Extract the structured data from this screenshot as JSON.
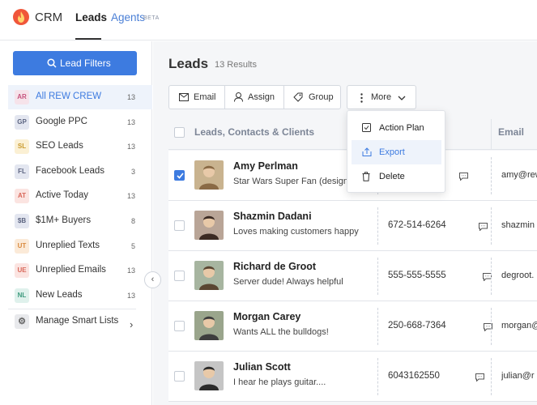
{
  "app": {
    "brand": "CRM"
  },
  "nav": {
    "tabs": [
      {
        "label": "Leads",
        "active": true
      },
      {
        "label": "Agents",
        "active": false
      }
    ],
    "beta_label": "BETA"
  },
  "sidebar": {
    "filter_button": "Lead Filters",
    "items": [
      {
        "badge": "AR",
        "label": "All REW CREW",
        "count": "13",
        "badge_bg": "#f6e3ea",
        "badge_color": "#c5537e",
        "active": true
      },
      {
        "badge": "GP",
        "label": "Google PPC",
        "count": "13",
        "badge_bg": "#e3e6f0",
        "badge_color": "#5c6480"
      },
      {
        "badge": "SL",
        "label": "SEO Leads",
        "count": "13",
        "badge_bg": "#fbf0d4",
        "badge_color": "#c99a2e"
      },
      {
        "badge": "FL",
        "label": "Facebook Leads",
        "count": "3",
        "badge_bg": "#e3e6f0",
        "badge_color": "#5c6480"
      },
      {
        "badge": "AT",
        "label": "Active Today",
        "count": "13",
        "badge_bg": "#fbe4e1",
        "badge_color": "#d9685a"
      },
      {
        "badge": "$B",
        "label": "$1M+ Buyers",
        "count": "8",
        "badge_bg": "#e3e6f0",
        "badge_color": "#5c6480"
      },
      {
        "badge": "UT",
        "label": "Unreplied Texts",
        "count": "5",
        "badge_bg": "#fbead8",
        "badge_color": "#d98a3e"
      },
      {
        "badge": "UE",
        "label": "Unreplied Emails",
        "count": "13",
        "badge_bg": "#fbe4e1",
        "badge_color": "#d9685a"
      },
      {
        "badge": "NL",
        "label": "New Leads",
        "count": "13",
        "badge_bg": "#dff1ec",
        "badge_color": "#3e9a7e"
      }
    ],
    "manage_label": "Manage Smart Lists"
  },
  "main": {
    "title": "Leads",
    "results": "13 Results",
    "toolbar": {
      "email": "Email",
      "assign": "Assign",
      "group": "Group",
      "more": "More"
    },
    "columns": {
      "leads": "Leads, Contacts & Clients",
      "email": "Email"
    },
    "rows": [
      {
        "name": "Amy Perlman",
        "desc": "Star Wars Super Fan (design",
        "phone": "",
        "email": "amy@rew",
        "checked": true
      },
      {
        "name": "Shazmin Dadani",
        "desc": "Loves making customers happy",
        "phone": "672-514-6264",
        "email": "shazmin",
        "checked": false
      },
      {
        "name": "Richard de Groot",
        "desc": "Server dude! Always helpful",
        "phone": "555-555-5555",
        "email": "degroot.",
        "checked": false
      },
      {
        "name": "Morgan Carey",
        "desc": "Wants ALL the bulldogs!",
        "phone": "250-668-7364",
        "email": "morgan@",
        "checked": false
      },
      {
        "name": "Julian Scott",
        "desc": "I hear he plays guitar....",
        "phone": "6043162550",
        "email": "julian@r",
        "checked": false
      }
    ]
  },
  "dropdown": {
    "items": [
      {
        "label": "Action Plan",
        "icon": "checklist-icon"
      },
      {
        "label": "Export",
        "icon": "export-icon",
        "active": true
      },
      {
        "label": "Delete",
        "icon": "trash-icon"
      }
    ]
  },
  "colors": {
    "accent": "#3d7be0",
    "brand": "#f0563a"
  }
}
